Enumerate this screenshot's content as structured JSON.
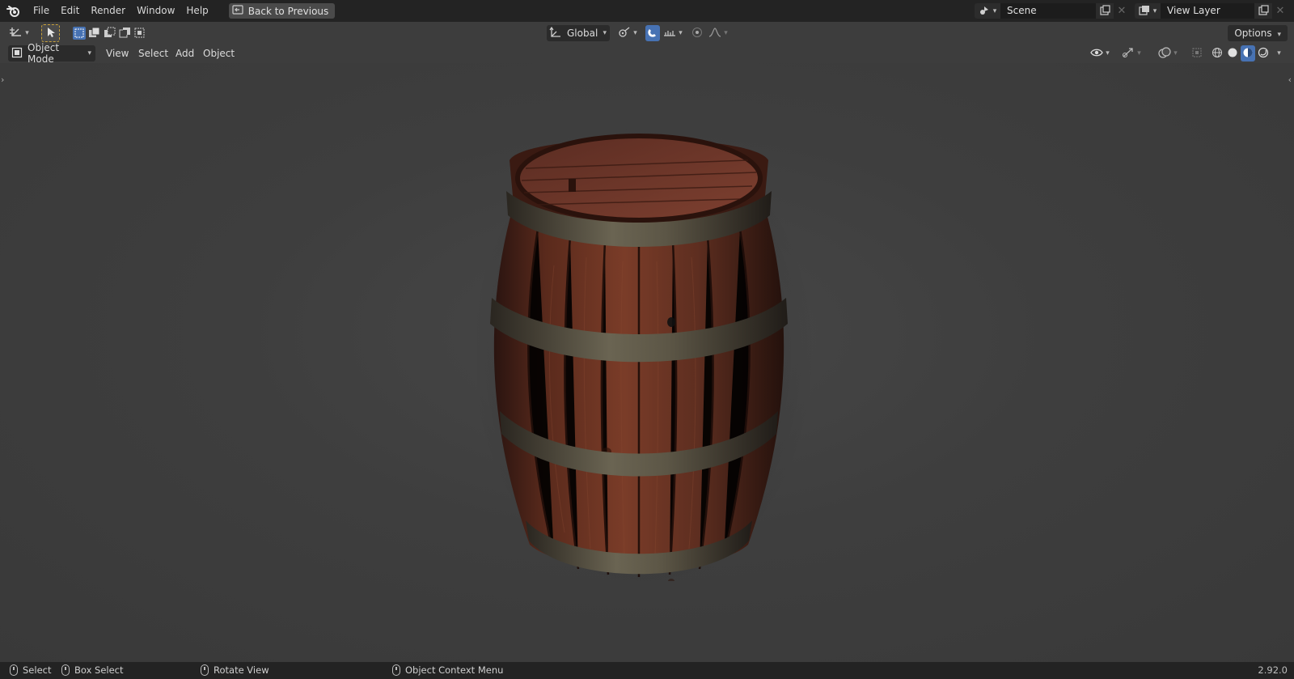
{
  "menu": {
    "items": [
      "File",
      "Edit",
      "Render",
      "Window",
      "Help"
    ],
    "back_label": "Back to Previous"
  },
  "scene": {
    "name": "Scene"
  },
  "view_layer": {
    "name": "View Layer"
  },
  "toolheader": {
    "orientation": "Global",
    "options_label": "Options"
  },
  "viewport_header": {
    "mode": "Object Mode",
    "menus": [
      "View",
      "Select",
      "Add",
      "Object"
    ]
  },
  "statusbar": {
    "select": "Select",
    "box_select": "Box Select",
    "rotate": "Rotate View",
    "context": "Object Context Menu",
    "version": "2.92.0"
  },
  "colors": {
    "accent": "#4772b3",
    "topbar": "#232323",
    "viewport": "#3d3d3d"
  }
}
